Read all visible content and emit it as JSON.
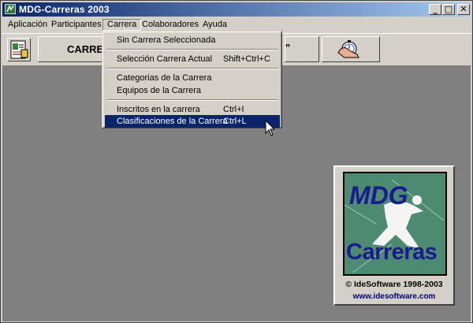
{
  "window": {
    "title": "MDG-Carreras 2003",
    "controls": [
      "_",
      "□",
      "✕"
    ]
  },
  "menubar": {
    "items": [
      "Aplicación",
      "Participantes",
      "Carrera",
      "Colaboradores",
      "Ayuda"
    ],
    "open_item": "Carrera"
  },
  "toolbar": {
    "race_label": "CARRER",
    "race_label_tail": "\""
  },
  "dropdown": {
    "items": [
      {
        "label": "Sin Carrera Seleccionada",
        "shortcut": ""
      },
      {
        "label": "Selección Carrera Actual",
        "shortcut": "Shift+Ctrl+C"
      },
      {
        "label": "Categorias de la Carrera",
        "shortcut": ""
      },
      {
        "label": "Equipos de la Carrera",
        "shortcut": ""
      },
      {
        "label": "Inscritos en la carrera",
        "shortcut": "Ctrl+I"
      },
      {
        "label": "Clasificaciones de la Carrera",
        "shortcut": "Ctrl+L"
      }
    ],
    "highlighted_index": 5
  },
  "logo": {
    "line1": "MDG",
    "line2": "Carreras",
    "copyright": "© IdeSoftware 1998-2003",
    "url": "www.idesoftware.com"
  },
  "colors": {
    "title_active": "#0a246a",
    "title_gradient_end": "#a6caf0",
    "menu_highlight": "#0a246a",
    "workspace": "#808080",
    "logo_green": "#4d8a72",
    "logo_text": "#1b1b8f"
  },
  "icons": [
    "app-icon",
    "participant-card-icon",
    "stopwatch-hand-icon",
    "mouse-cursor-icon"
  ]
}
